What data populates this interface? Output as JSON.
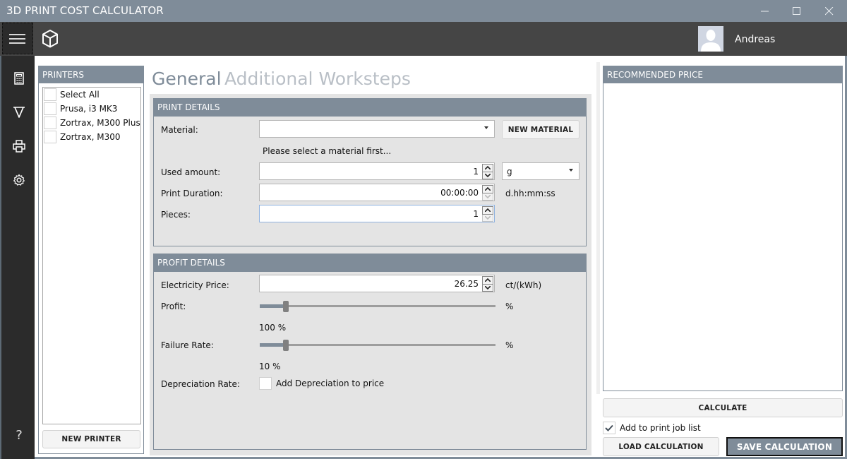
{
  "window": {
    "title": "3D PRINT COST CALCULATOR",
    "controls": {
      "minimize": "minimize-icon",
      "maximize": "maximize-icon",
      "close": "close-icon"
    }
  },
  "appbar": {
    "menu_icon": "hamburger-icon",
    "logo_icon": "cube-icon",
    "user_name": "Andreas"
  },
  "rail": {
    "items": [
      {
        "icon": "calculator-icon"
      },
      {
        "icon": "nozzle-icon"
      },
      {
        "icon": "printer-icon"
      },
      {
        "icon": "gear-icon"
      }
    ],
    "help_label": "?"
  },
  "printers": {
    "header": "PRINTERS",
    "items": [
      {
        "label": "Select All",
        "checked": false
      },
      {
        "label": "Prusa, i3 MK3",
        "checked": false
      },
      {
        "label": "Zortrax, M300 Plus",
        "checked": false
      },
      {
        "label": "Zortrax, M300",
        "checked": false
      }
    ],
    "new_button": "NEW PRINTER"
  },
  "tabs": [
    {
      "label": "General",
      "active": true
    },
    {
      "label": "Additional Worksteps",
      "active": false
    }
  ],
  "print_details": {
    "header": "PRINT DETAILS",
    "material_label": "Material:",
    "material_value": "",
    "material_hint": "Please select a material first...",
    "new_material_button": "NEW MATERIAL",
    "used_amount_label": "Used amount:",
    "used_amount_value": "1",
    "used_amount_unit": "g",
    "print_duration_label": "Print Duration:",
    "print_duration_value": "00:00:00",
    "print_duration_format": "d.hh:mm:ss",
    "pieces_label": "Pieces:",
    "pieces_value": "1"
  },
  "profit_details": {
    "header": "PROFIT DETAILS",
    "electricity_label": "Electricity Price:",
    "electricity_value": "26.25",
    "electricity_unit": "ct/(kWh)",
    "profit_label": "Profit:",
    "profit_unit": "%",
    "profit_value_text": "100 %",
    "profit_slider_fraction": 0.11,
    "failure_label": "Failure Rate:",
    "failure_unit": "%",
    "failure_value_text": "10 %",
    "failure_slider_fraction": 0.11,
    "depreciation_label": "Depreciation Rate:",
    "depreciation_checkbox_label": "Add Depreciation to price",
    "depreciation_checked": false
  },
  "recommended": {
    "header": "RECOMMENDED PRICE",
    "calculate_button": "CALCULATE",
    "add_to_job_list_label": "Add to print job list",
    "add_to_job_list_checked": true,
    "load_button": "LOAD CALCULATION",
    "save_button": "SAVE CALCULATION"
  },
  "colors": {
    "accent": "#7f8c99",
    "rail_bg": "#2b2b2b",
    "appbar_bg": "#454545",
    "panel_bg": "#e4e4e4"
  }
}
